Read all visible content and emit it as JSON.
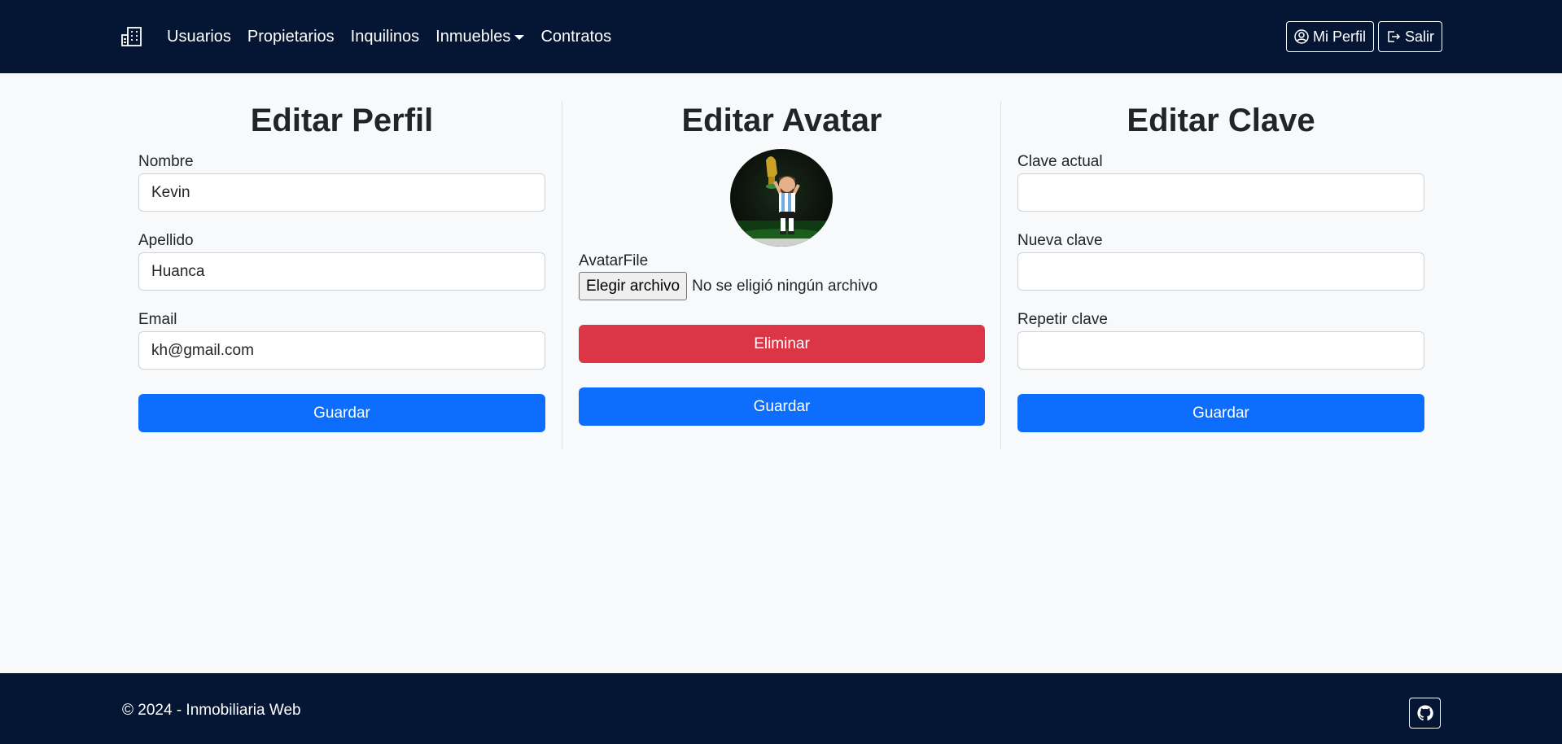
{
  "navbar": {
    "brand_icon": "building-icon",
    "links": [
      "Usuarios",
      "Propietarios",
      "Inquilinos",
      "Inmuebles",
      "Contratos"
    ],
    "profile_label": "Mi Perfil",
    "logout_label": "Salir",
    "bg_color": "#041634"
  },
  "perfil": {
    "title": "Editar Perfil",
    "nombre_label": "Nombre",
    "nombre_value": "Kevin",
    "apellido_label": "Apellido",
    "apellido_value": "Huanca",
    "email_label": "Email",
    "email_value": "kh@gmail.com",
    "save_label": "Guardar"
  },
  "avatar": {
    "title": "Editar Avatar",
    "file_label": "AvatarFile",
    "choose_label": "Elegir archivo",
    "no_file_text": "No se eligió ningún archivo",
    "delete_label": "Eliminar",
    "save_label": "Guardar"
  },
  "clave": {
    "title": "Editar Clave",
    "actual_label": "Clave actual",
    "actual_value": "",
    "nueva_label": "Nueva clave",
    "nueva_value": "",
    "repetir_label": "Repetir clave",
    "repetir_value": "",
    "save_label": "Guardar"
  },
  "footer": {
    "text": "© 2024 - Inmobiliaria Web",
    "github_icon": "github-icon"
  },
  "colors": {
    "primary": "#0d6efd",
    "danger": "#dc3545",
    "page_bg": "#f8f9fa"
  }
}
